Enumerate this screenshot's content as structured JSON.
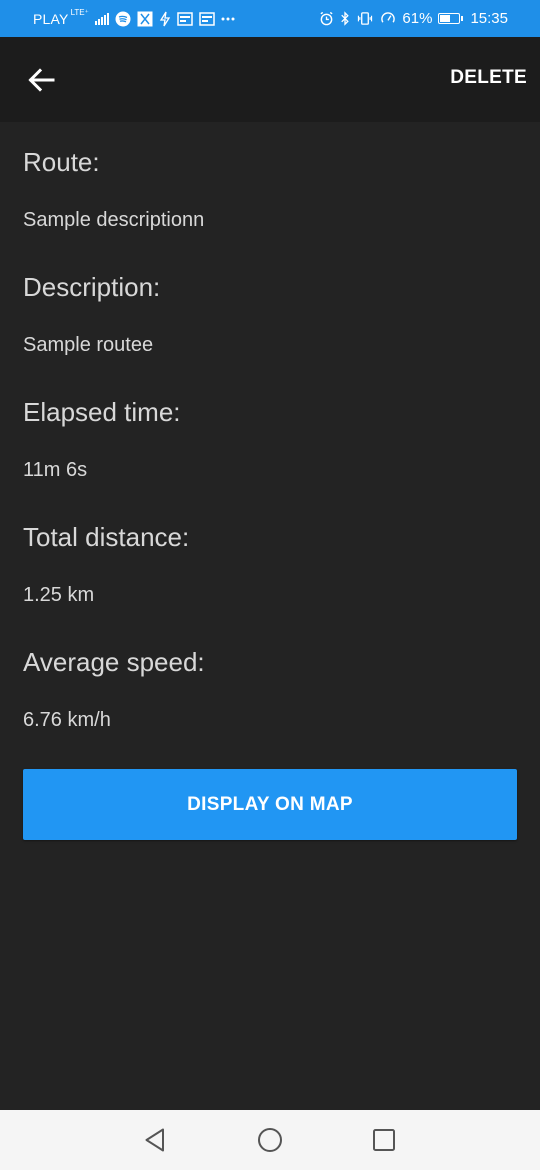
{
  "status_bar": {
    "carrier": "PLAY",
    "network": "LTE⁺",
    "battery_percent": "61%",
    "battery_level": 0.61,
    "time": "15:35",
    "icons": [
      "signal-icon",
      "spotify-icon",
      "notification-icon",
      "flash-icon",
      "card-icon",
      "card-icon",
      "more-dots-icon",
      "alarm-icon",
      "bluetooth-icon",
      "vibrate-icon",
      "speed-icon",
      "battery-icon"
    ],
    "color": "#1f8fe8"
  },
  "app_bar": {
    "back_icon": "arrow-left-icon",
    "delete_label": "DELETE"
  },
  "fields": [
    {
      "label": "Route:",
      "value": "Sample descriptionn"
    },
    {
      "label": "Description:",
      "value": "Sample routee"
    },
    {
      "label": "Elapsed time:",
      "value": "11m 6s"
    },
    {
      "label": "Total distance:",
      "value": "1.25 km"
    },
    {
      "label": "Average speed:",
      "value": "6.76 km/h"
    }
  ],
  "actions": {
    "display_on_map_label": "DISPLAY ON MAP",
    "accent_color": "#2196f3"
  },
  "nav_bar": {
    "back_icon": "triangle-back-icon",
    "home_icon": "circle-home-icon",
    "recents_icon": "square-recents-icon"
  }
}
